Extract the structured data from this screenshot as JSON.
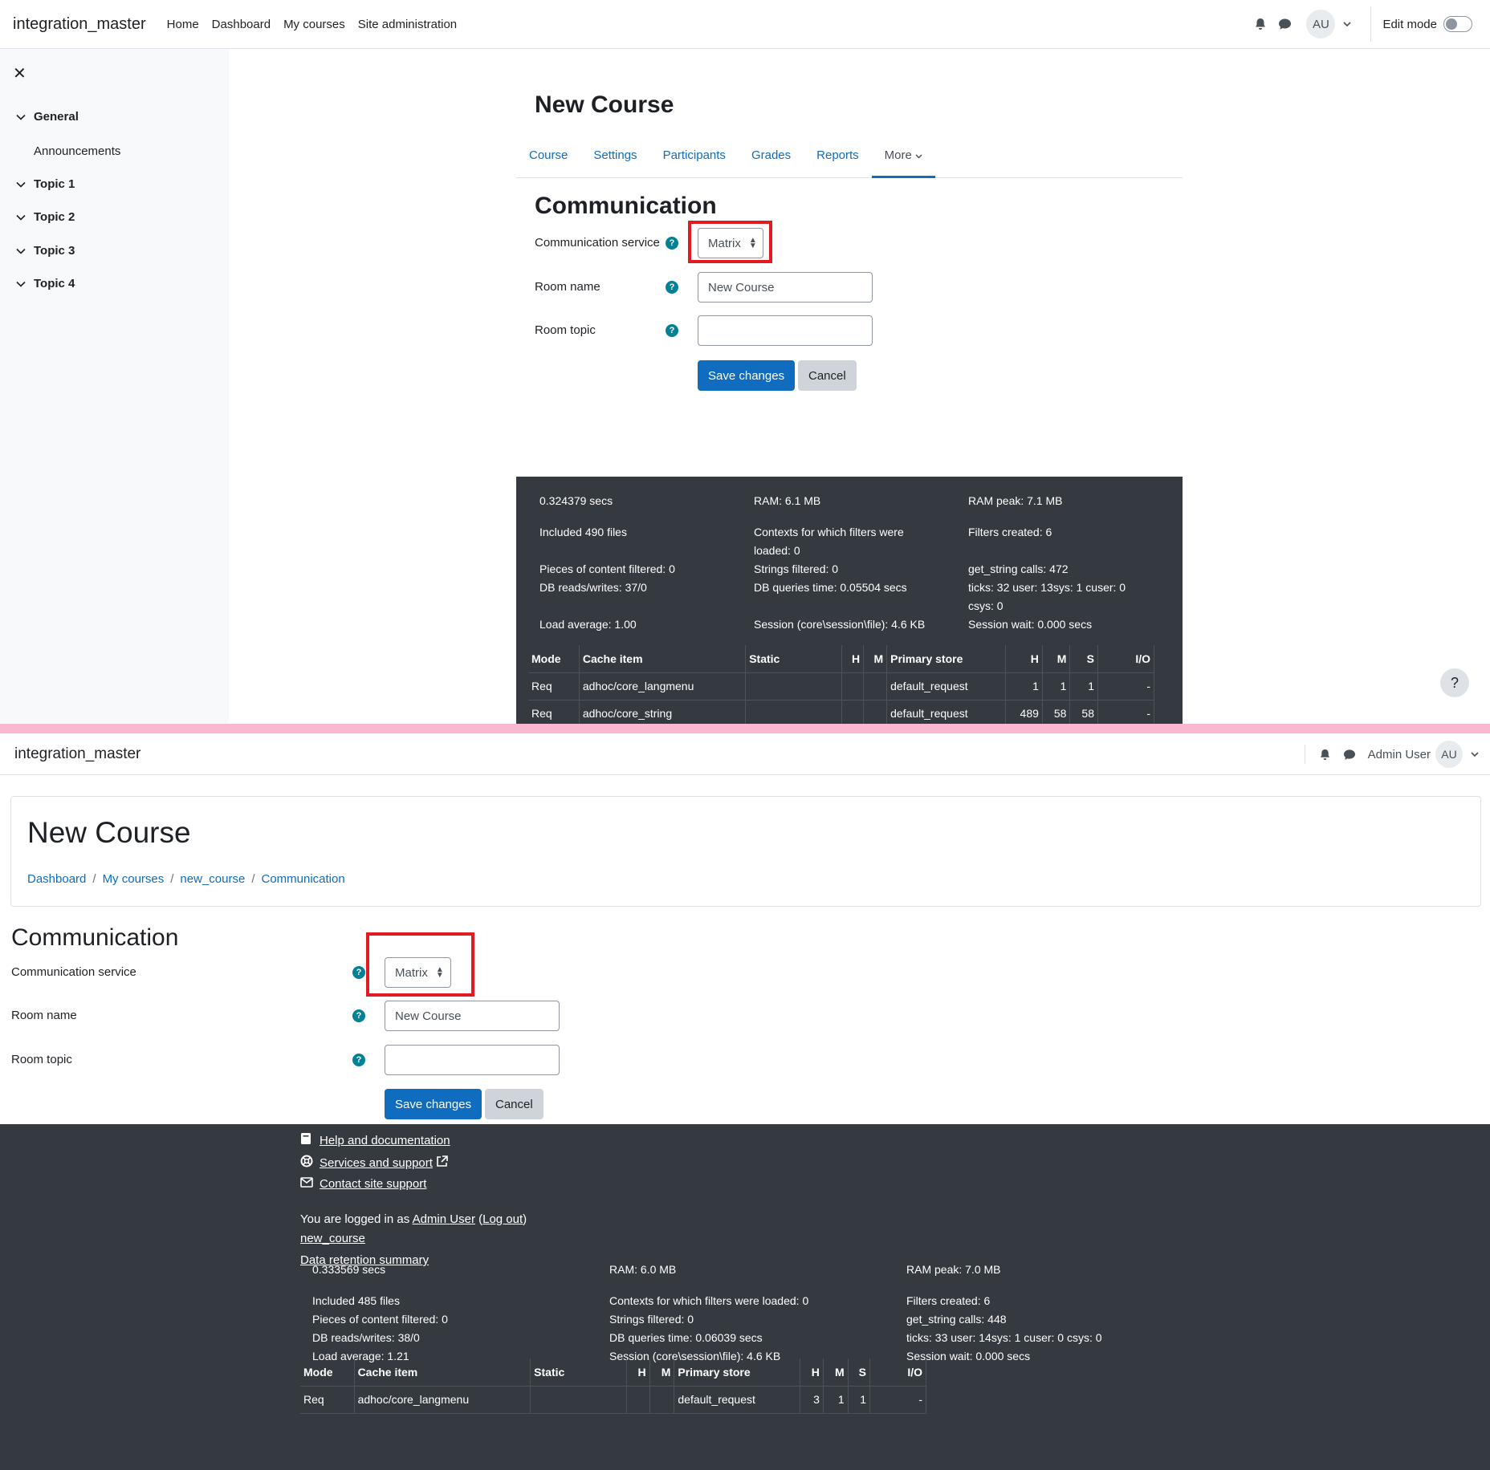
{
  "top": {
    "brand": "integration_master",
    "primary_nav": [
      "Home",
      "Dashboard",
      "My courses",
      "Site administration"
    ],
    "avatar_initials": "AU",
    "edit_mode_label": "Edit mode",
    "drawer": {
      "close_glyph": "✕",
      "sections": [
        {
          "label": "General",
          "items": [
            "Announcements"
          ]
        },
        {
          "label": "Topic 1"
        },
        {
          "label": "Topic 2"
        },
        {
          "label": "Topic 3"
        },
        {
          "label": "Topic 4"
        }
      ]
    },
    "course_title": "New Course",
    "secondary_nav": [
      "Course",
      "Settings",
      "Participants",
      "Grades",
      "Reports",
      "More"
    ],
    "heading": "Communication",
    "form": {
      "service_label": "Communication service",
      "service_value": "Matrix",
      "room_name_label": "Room name",
      "room_name_value": "New Course",
      "room_topic_label": "Room topic",
      "room_topic_value": "",
      "save_label": "Save changes",
      "cancel_label": "Cancel"
    },
    "perf": {
      "rows": [
        [
          "0.324379 secs",
          "RAM: 6.1 MB",
          "RAM peak: 7.1 MB"
        ],
        [
          "Included 490 files",
          "Contexts for which filters were",
          "Filters created: 6"
        ],
        [
          "",
          "loaded: 0",
          ""
        ],
        [
          "Pieces of content filtered: 0",
          "Strings filtered: 0",
          "get_string calls: 472"
        ],
        [
          "DB reads/writes: 37/0",
          "DB queries time: 0.05504 secs",
          "ticks: 32 user: 13sys: 1 cuser: 0"
        ],
        [
          "",
          "",
          "csys: 0"
        ],
        [
          "Load average: 1.00",
          "Session (core\\session\\file): 4.6 KB",
          "Session wait: 0.000 secs"
        ]
      ],
      "cache_headers": [
        "Mode",
        "Cache item",
        "Static",
        "H",
        "M",
        "Primary store",
        "H",
        "M",
        "S",
        "I/O"
      ],
      "cache_rows": [
        [
          "Req",
          "adhoc/core_langmenu",
          "",
          "",
          "",
          "default_request",
          "1",
          "1",
          "1",
          "-"
        ],
        [
          "Req",
          "adhoc/core_string",
          "",
          "",
          "",
          "default_request",
          "489",
          "58",
          "58",
          "-"
        ]
      ]
    },
    "help_glyph": "?"
  },
  "bottom": {
    "brand": "integration_master",
    "user_name": "Admin User",
    "avatar_initials": "AU",
    "course_title": "New Course",
    "breadcrumbs": [
      "Dashboard",
      "My courses",
      "new_course",
      "Communication"
    ],
    "heading": "Communication",
    "form": {
      "service_label": "Communication service",
      "service_value": "Matrix",
      "room_name_label": "Room name",
      "room_name_value": "New Course",
      "room_topic_label": "Room topic",
      "room_topic_value": "",
      "save_label": "Save changes",
      "cancel_label": "Cancel"
    },
    "footer": {
      "help_link": "Help and documentation",
      "services_link": "Services and support",
      "contact_link": "Contact site support",
      "logged_in_prefix": "You are logged in as",
      "logged_in_user": "Admin User",
      "logout": "Log out",
      "course_link": "new_course",
      "retention_link": "Data retention summary"
    },
    "perf": {
      "rows": [
        [
          "0.333569 secs",
          "RAM: 6.0 MB",
          "RAM peak: 7.0 MB"
        ],
        [
          "Included 485 files",
          "Contexts for which filters were loaded: 0",
          "Filters created: 6"
        ],
        [
          "Pieces of content filtered: 0",
          "Strings filtered: 0",
          "get_string calls: 448"
        ],
        [
          "DB reads/writes: 38/0",
          "DB queries time: 0.06039 secs",
          "ticks: 33 user: 14sys: 1 cuser: 0 csys: 0"
        ],
        [
          "Load average: 1.21",
          "Session (core\\session\\file): 4.6 KB",
          "Session wait: 0.000 secs"
        ]
      ],
      "cache_headers": [
        "Mode",
        "Cache item",
        "Static",
        "H",
        "M",
        "Primary store",
        "H",
        "M",
        "S",
        "I/O"
      ],
      "cache_rows": [
        [
          "Req",
          "adhoc/core_langmenu",
          "",
          "",
          "",
          "default_request",
          "3",
          "1",
          "1",
          "-"
        ]
      ]
    }
  }
}
